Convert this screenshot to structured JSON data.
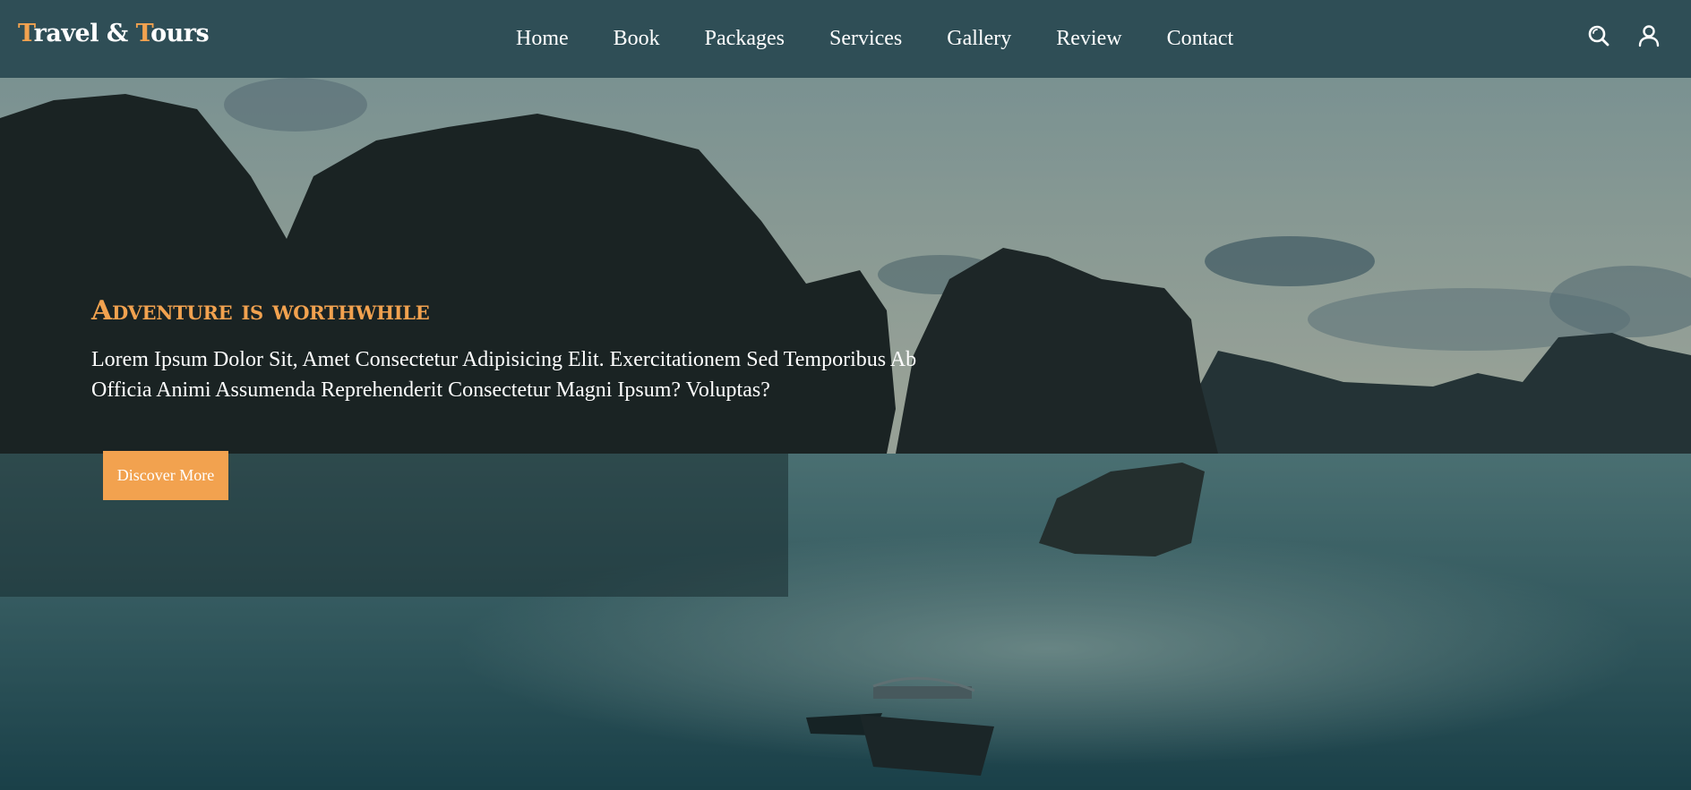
{
  "brand": {
    "first_initial": "T",
    "first_rest": "ravel & ",
    "second_initial": "T",
    "second_rest": "ours"
  },
  "nav": {
    "items": [
      {
        "label": "Home"
      },
      {
        "label": "Book"
      },
      {
        "label": "Packages"
      },
      {
        "label": "Services"
      },
      {
        "label": "Gallery"
      },
      {
        "label": "Review"
      },
      {
        "label": "Contact"
      }
    ]
  },
  "header_icons": [
    "search-icon",
    "user-icon"
  ],
  "hero": {
    "title": "Adventure is worthwhile",
    "text": "Lorem Ipsum Dolor Sit, Amet Consectetur Adipisicing Elit. Exercitationem Sed Temporibus Ab Officia Animi Assumenda Reprehenderit Consectetur Magni Ipsum? Voluptas?",
    "button_label": "Discover More"
  },
  "colors": {
    "header_bg": "#2f4e56",
    "accent": "#f2a24f",
    "text": "#ffffff"
  }
}
